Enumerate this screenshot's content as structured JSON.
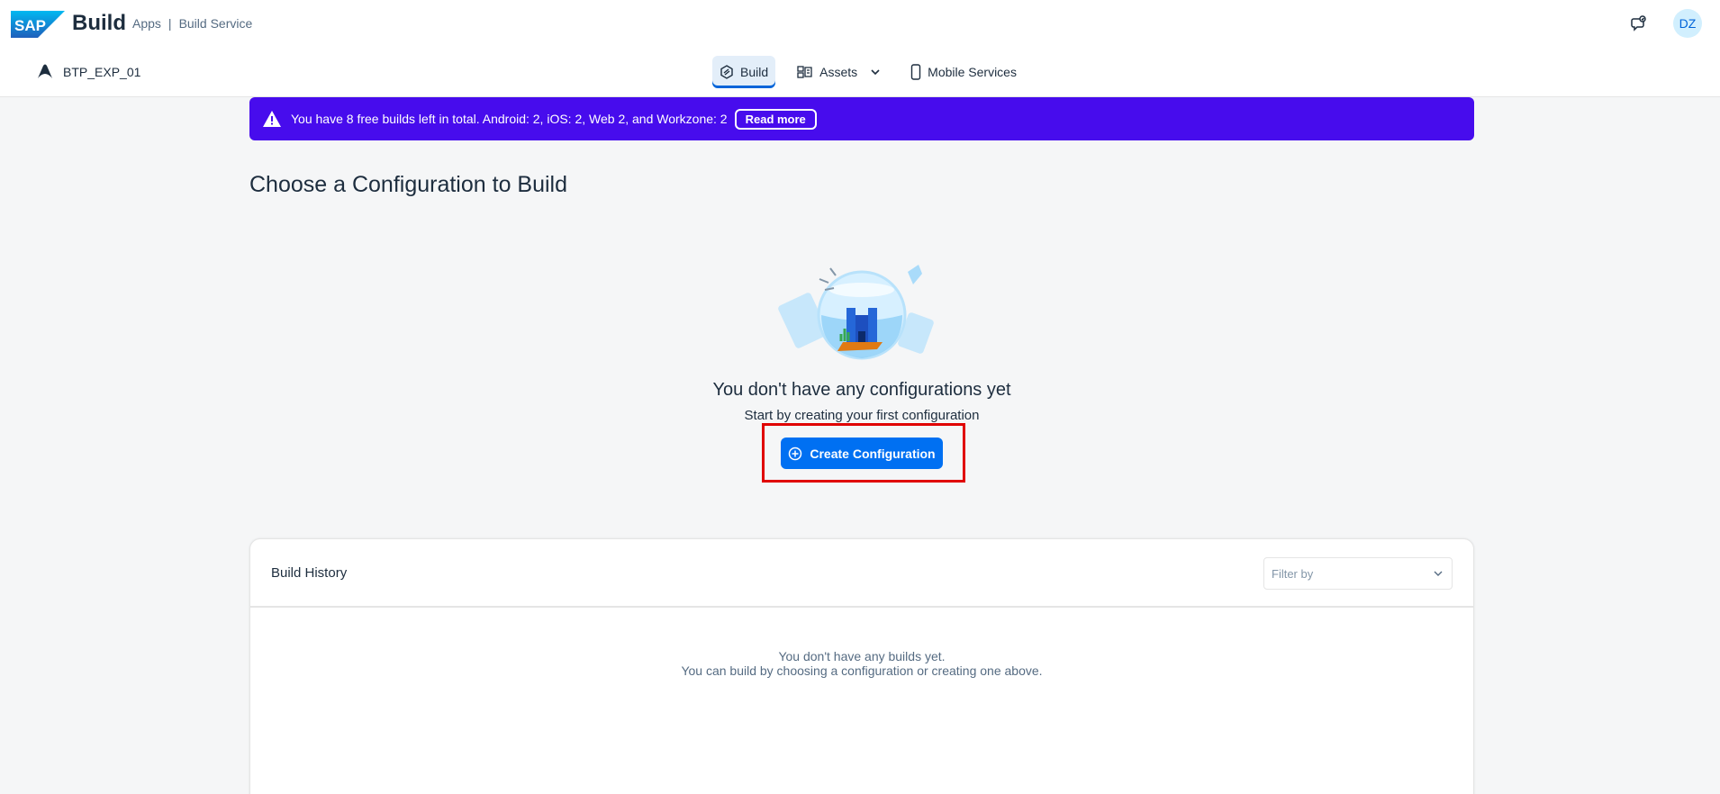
{
  "shell": {
    "logo_text": "SAP",
    "product": "Build",
    "breadcrumb": [
      "Apps",
      "Build Service"
    ],
    "breadcrumb_separator": "|",
    "avatar_initials": "DZ"
  },
  "project": {
    "name": "BTP_EXP_01"
  },
  "tabs": [
    {
      "label": "Build",
      "icon": "build-icon",
      "active": true
    },
    {
      "label": "Assets",
      "icon": "assets-icon",
      "dropdown": true
    },
    {
      "label": "Mobile Services",
      "icon": "mobile-icon"
    }
  ],
  "banner": {
    "text": "You have 8 free builds left in total. Android: 2, iOS: 2, Web 2, and Workzone: 2",
    "button": "Read more",
    "color": "#470ced"
  },
  "page": {
    "title": "Choose a Configuration to Build"
  },
  "empty_state": {
    "title": "You don't have any configurations yet",
    "subtitle": "Start by creating your first configuration",
    "button": "Create Configuration"
  },
  "history": {
    "title": "Build History",
    "filter_placeholder": "Filter by",
    "empty_line1": "You don't have any builds yet.",
    "empty_line2": "You can build by choosing a configuration or creating one above."
  },
  "colors": {
    "accent": "#0070f2",
    "highlight": "#e00000"
  }
}
